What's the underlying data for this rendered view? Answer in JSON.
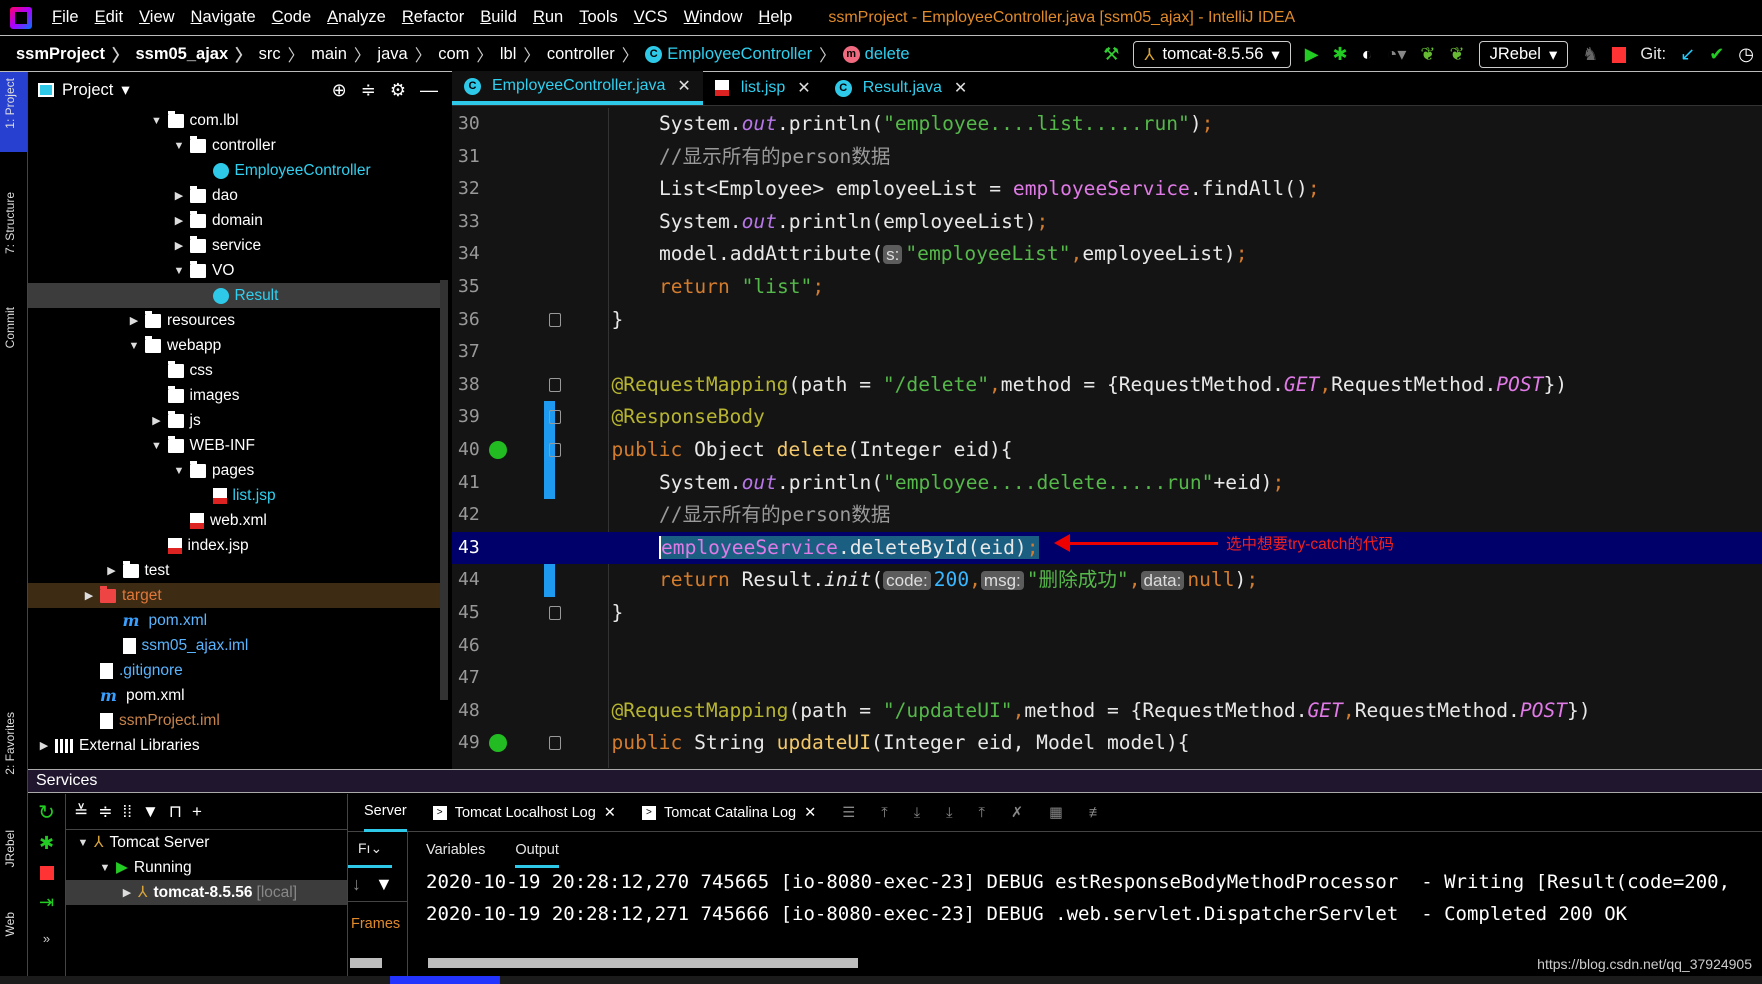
{
  "menubar": {
    "items": [
      "File",
      "Edit",
      "View",
      "Navigate",
      "Code",
      "Analyze",
      "Refactor",
      "Build",
      "Run",
      "Tools",
      "VCS",
      "Window",
      "Help"
    ],
    "title": "ssmProject - EmployeeController.java [ssm05_ajax] - IntelliJ IDEA"
  },
  "breadcrumb": [
    "ssmProject",
    "ssm05_ajax",
    "src",
    "main",
    "java",
    "com",
    "lbl",
    "controller",
    "EmployeeController",
    "delete"
  ],
  "toolbar": {
    "run_config": "tomcat-8.5.56",
    "jrebel": "JRebel",
    "git_label": "Git:",
    "icons": [
      "hammer-icon",
      "run-icon",
      "debug-icon",
      "coverage-icon",
      "profile-icon",
      "jrebel-run-icon",
      "jrebel-debug-icon",
      "ant-icon",
      "stop-icon",
      "git-update-icon",
      "git-commit-icon",
      "history-icon"
    ]
  },
  "left_stripe": [
    "1: Project",
    "7: Structure",
    "Commit",
    "2: Favorites",
    "JRebel",
    "Web"
  ],
  "project": {
    "title": "Project",
    "tree": [
      {
        "label": "com.lbl",
        "indent": 5,
        "open": true,
        "icon": "folder"
      },
      {
        "label": "controller",
        "indent": 6,
        "open": true,
        "icon": "folder"
      },
      {
        "label": "EmployeeController",
        "indent": 7,
        "icon": "cls",
        "color": "#2fd0f0"
      },
      {
        "label": "dao",
        "indent": 6,
        "open": false,
        "icon": "folder"
      },
      {
        "label": "domain",
        "indent": 6,
        "open": false,
        "icon": "folder"
      },
      {
        "label": "service",
        "indent": 6,
        "open": false,
        "icon": "folder"
      },
      {
        "label": "VO",
        "indent": 6,
        "open": true,
        "icon": "folder"
      },
      {
        "label": "Result",
        "indent": 7,
        "icon": "cls",
        "color": "#2fd0f0",
        "selected": true
      },
      {
        "label": "resources",
        "indent": 4,
        "open": false,
        "icon": "folder"
      },
      {
        "label": "webapp",
        "indent": 4,
        "open": true,
        "icon": "folder"
      },
      {
        "label": "css",
        "indent": 5,
        "icon": "folder"
      },
      {
        "label": "images",
        "indent": 5,
        "icon": "folder"
      },
      {
        "label": "js",
        "indent": 5,
        "open": false,
        "icon": "folder"
      },
      {
        "label": "WEB-INF",
        "indent": 5,
        "open": true,
        "icon": "folder"
      },
      {
        "label": "pages",
        "indent": 6,
        "open": true,
        "icon": "folder"
      },
      {
        "label": "list.jsp",
        "indent": 7,
        "icon": "jsp",
        "color": "#2fd0f0"
      },
      {
        "label": "web.xml",
        "indent": 6,
        "icon": "xml"
      },
      {
        "label": "index.jsp",
        "indent": 5,
        "icon": "jsp"
      },
      {
        "label": "test",
        "indent": 3,
        "open": false,
        "icon": "folder"
      },
      {
        "label": "target",
        "indent": 2,
        "open": false,
        "icon": "folder red",
        "color": "#e0783a",
        "excluded": true
      },
      {
        "label": "pom.xml",
        "indent": 3,
        "icon": "mvn",
        "color": "#5ab4ff"
      },
      {
        "label": "ssm05_ajax.iml",
        "indent": 3,
        "icon": "file",
        "color": "#5ab4ff"
      },
      {
        "label": ".gitignore",
        "indent": 2,
        "icon": "file",
        "color": "#5ab4ff"
      },
      {
        "label": "pom.xml",
        "indent": 2,
        "icon": "mvn"
      },
      {
        "label": "ssmProject.iml",
        "indent": 2,
        "icon": "file",
        "color": "#c8834a"
      },
      {
        "label": "External Libraries",
        "indent": 0,
        "open": false,
        "icon": "lib"
      }
    ]
  },
  "editor": {
    "tabs": [
      {
        "label": "EmployeeController.java",
        "icon": "class-icon",
        "active": true
      },
      {
        "label": "list.jsp",
        "icon": "jsp-icon"
      },
      {
        "label": "Result.java",
        "icon": "class-icon"
      }
    ],
    "selected_line": 43,
    "lines": [
      {
        "n": 30,
        "i": 2,
        "seg": [
          [
            "d",
            "System."
          ],
          [
            "f",
            "out"
          ],
          [
            "d",
            ".println("
          ],
          [
            "s",
            "\"employee....list.....run\""
          ],
          [
            "d",
            ")"
          ],
          [
            "k",
            ";"
          ]
        ]
      },
      {
        "n": 31,
        "i": 2,
        "seg": [
          [
            "c",
            "//显示所有的person数据"
          ]
        ]
      },
      {
        "n": 32,
        "i": 2,
        "seg": [
          [
            "d",
            "List<Employee> employeeList = "
          ],
          [
            "p",
            "employeeService"
          ],
          [
            "d",
            ".findAll()"
          ],
          [
            "k",
            ";"
          ]
        ]
      },
      {
        "n": 33,
        "i": 2,
        "seg": [
          [
            "d",
            "System."
          ],
          [
            "f",
            "out"
          ],
          [
            "d",
            ".println(employeeList)"
          ],
          [
            "k",
            ";"
          ]
        ]
      },
      {
        "n": 34,
        "i": 2,
        "seg": [
          [
            "d",
            "model.addAttribute("
          ],
          [
            "h",
            "s:"
          ],
          [
            "s",
            "\"employeeList\""
          ],
          [
            "k",
            ","
          ],
          [
            "d",
            "employeeList)"
          ],
          [
            "k",
            ";"
          ]
        ]
      },
      {
        "n": 35,
        "i": 2,
        "seg": [
          [
            "k",
            "return "
          ],
          [
            "s",
            "\"list\""
          ],
          [
            "k",
            ";"
          ]
        ]
      },
      {
        "n": 36,
        "i": 1,
        "seg": [
          [
            "d",
            "}"
          ]
        ]
      },
      {
        "n": 37,
        "i": 1,
        "seg": []
      },
      {
        "n": 38,
        "i": 1,
        "seg": [
          [
            "a",
            "@RequestMapping"
          ],
          [
            "d",
            "(path = "
          ],
          [
            "s",
            "\"/delete\""
          ],
          [
            "k",
            ","
          ],
          [
            "d",
            "method = {RequestMethod."
          ],
          [
            "pi",
            "GET"
          ],
          [
            "k",
            ","
          ],
          [
            "d",
            "RequestMethod."
          ],
          [
            "pi",
            "POST"
          ],
          [
            "d",
            "})"
          ]
        ]
      },
      {
        "n": 39,
        "i": 1,
        "seg": [
          [
            "a",
            "@ResponseBody"
          ]
        ]
      },
      {
        "n": 40,
        "i": 1,
        "seg": [
          [
            "k",
            "public "
          ],
          [
            "d",
            "Object "
          ],
          [
            "m",
            "delete"
          ],
          [
            "d",
            "(Integer eid){"
          ]
        ]
      },
      {
        "n": 41,
        "i": 2,
        "seg": [
          [
            "d",
            "System."
          ],
          [
            "f",
            "out"
          ],
          [
            "d",
            ".println("
          ],
          [
            "s",
            "\"employee....delete.....run\""
          ],
          [
            "d",
            "+eid)"
          ],
          [
            "k",
            ";"
          ]
        ]
      },
      {
        "n": 42,
        "i": 2,
        "seg": [
          [
            "c",
            "//显示所有的person数据"
          ]
        ]
      },
      {
        "n": 43,
        "i": 2,
        "seg": [
          [
            "p",
            "employeeService"
          ],
          [
            "d",
            ".deleteById(eid)"
          ],
          [
            "k",
            ";"
          ]
        ]
      },
      {
        "n": 44,
        "i": 2,
        "seg": [
          [
            "k",
            "return "
          ],
          [
            "d",
            "Result."
          ],
          [
            "i",
            "init"
          ],
          [
            "d",
            "("
          ],
          [
            "h",
            "code:"
          ],
          [
            "n",
            "200"
          ],
          [
            "k",
            ","
          ],
          [
            "h",
            "msg:"
          ],
          [
            "s",
            "\"删除成功\""
          ],
          [
            "k",
            ","
          ],
          [
            "h",
            "data:"
          ],
          [
            "k",
            "null"
          ],
          [
            "d",
            ")"
          ],
          [
            "k",
            ";"
          ]
        ]
      },
      {
        "n": 45,
        "i": 1,
        "seg": [
          [
            "d",
            "}"
          ]
        ]
      },
      {
        "n": 46,
        "i": 1,
        "seg": []
      },
      {
        "n": 47,
        "i": 1,
        "seg": []
      },
      {
        "n": 48,
        "i": 1,
        "seg": [
          [
            "a",
            "@RequestMapping"
          ],
          [
            "d",
            "(path = "
          ],
          [
            "s",
            "\"/updateUI\""
          ],
          [
            "k",
            ","
          ],
          [
            "d",
            "method = {RequestMethod."
          ],
          [
            "pi",
            "GET"
          ],
          [
            "k",
            ","
          ],
          [
            "d",
            "RequestMethod."
          ],
          [
            "pi",
            "POST"
          ],
          [
            "d",
            "})"
          ]
        ]
      },
      {
        "n": 49,
        "i": 1,
        "seg": [
          [
            "k",
            "public "
          ],
          [
            "d",
            "String "
          ],
          [
            "m",
            "updateUI"
          ],
          [
            "d",
            "(Integer eid, Model model){"
          ]
        ]
      }
    ],
    "annotation": "选中想要try-catch的代码"
  },
  "services": {
    "title": "Services",
    "tree": [
      {
        "label": "Tomcat Server",
        "level": 0
      },
      {
        "label": "Running",
        "level": 1
      },
      {
        "label": "tomcat-8.5.56",
        "suffix": "[local]",
        "level": 2,
        "selected": true
      }
    ],
    "tabs": [
      {
        "label": "Server",
        "active": true
      },
      {
        "label": "Tomcat Localhost Log"
      },
      {
        "label": "Tomcat Catalina Log"
      }
    ],
    "frames_short": "Fı",
    "frames_label": "Frames",
    "subtabs": [
      "Variables",
      "Output"
    ],
    "console": [
      "2020-10-19 20:28:12,270 745665 [io-8080-exec-23] DEBUG estResponseBodyMethodProcessor  - Writing [Result(code=200,",
      "2020-10-19 20:28:12,271 745666 [io-8080-exec-23] DEBUG .web.servlet.DispatcherServlet  - Completed 200 OK"
    ]
  },
  "watermark": "https://blog.csdn.net/qq_37924905",
  "colors": {
    "accent": "#2ec9e8",
    "keyword": "#d47c2e",
    "string": "#55b84a",
    "selection": "#1a5f82",
    "current_line": "#00006b",
    "annotation_red": "#f02020"
  }
}
